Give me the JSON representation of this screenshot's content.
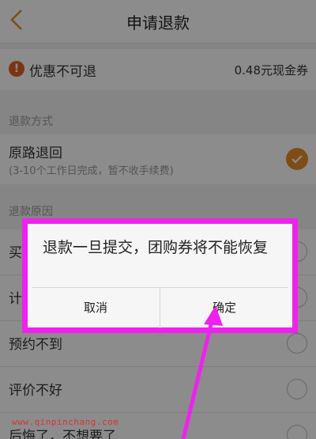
{
  "nav": {
    "title": "申请退款",
    "back_icon": "back-chevron-icon"
  },
  "coupon": {
    "label": "优惠不可退",
    "value": "0.48元现金券",
    "icon": "warning-icon"
  },
  "refund_method": {
    "section_label": "退款方式",
    "option_title": "原路退回",
    "option_sub": "(3-10个工作日完成，暂不收手续费)",
    "selected": true
  },
  "refund_reason": {
    "section_label": "退款原因",
    "items": [
      {
        "label": "买"
      },
      {
        "label": "计"
      },
      {
        "label": "预约不到"
      },
      {
        "label": "评价不好"
      },
      {
        "label": "后悔了，不想要了"
      }
    ]
  },
  "dialog": {
    "message": "退款一旦提交，团购券将不能恢复",
    "cancel_label": "取消",
    "confirm_label": "确定",
    "highlight_color": "#ee22ee"
  },
  "watermark": "www.qinpinchang.com",
  "colors": {
    "accent": "#e58a2a",
    "warning": "#e15f21",
    "annotation": "#ee22ee"
  }
}
